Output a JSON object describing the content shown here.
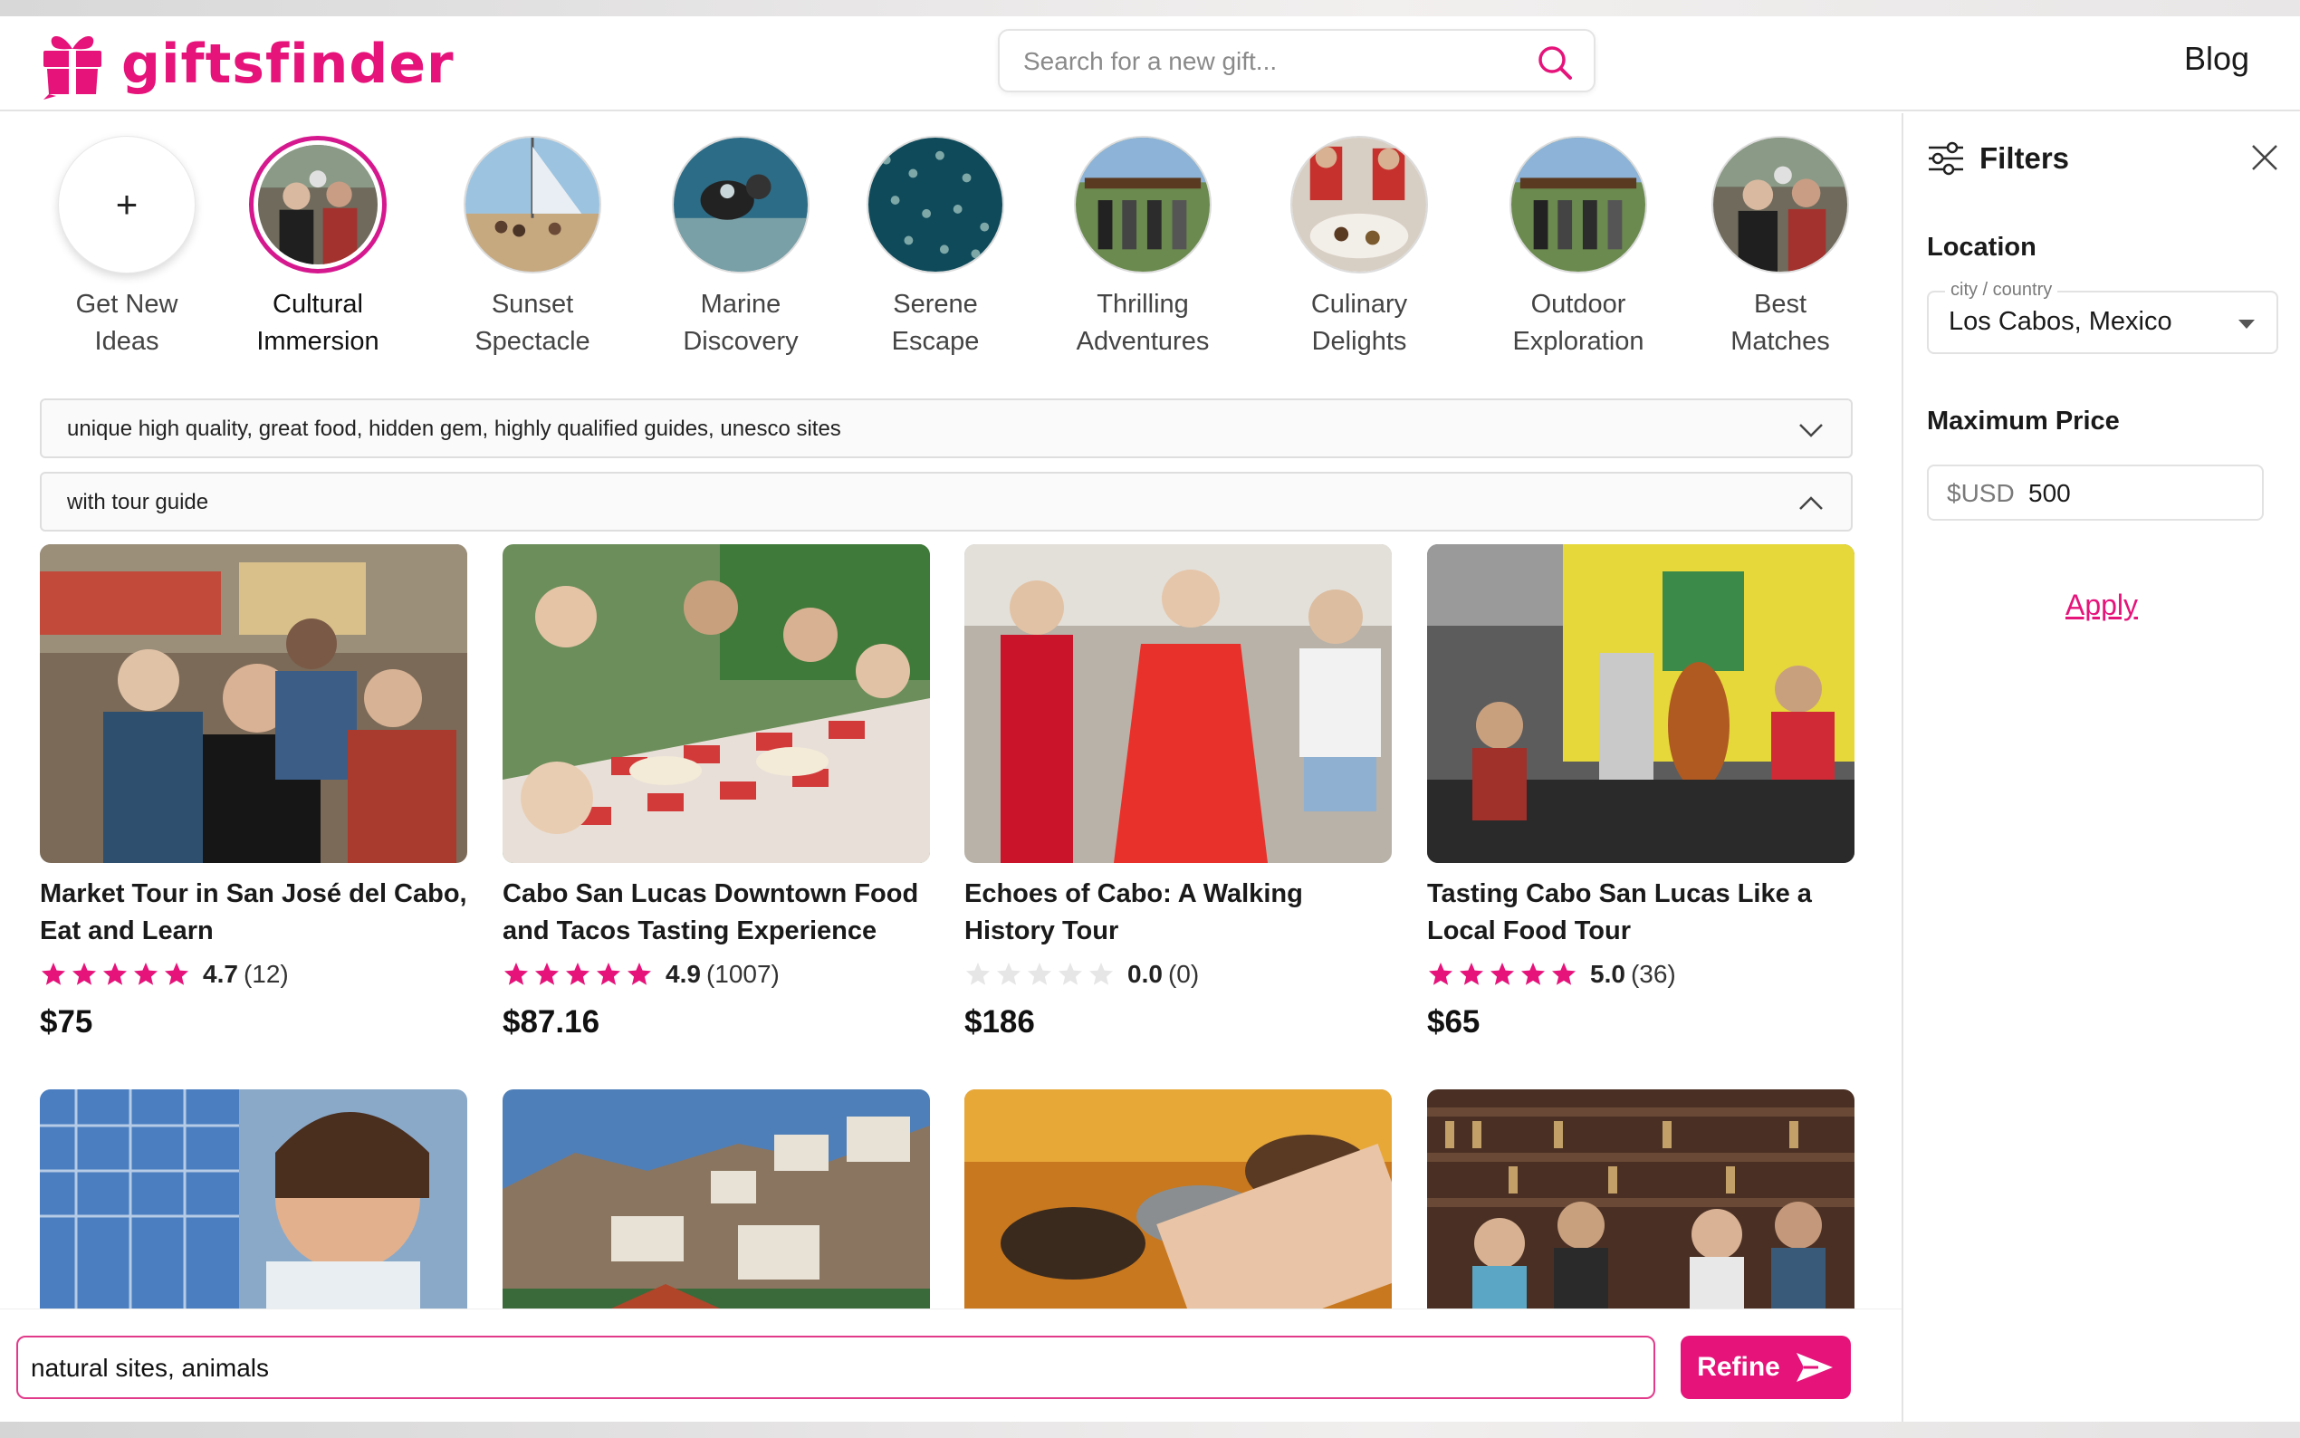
{
  "header": {
    "logo_text": "giftsfinder",
    "search_placeholder": "Search for a new gift...",
    "blog_label": "Blog"
  },
  "categories": [
    {
      "label": "Get New\nIdeas"
    },
    {
      "label": "Cultural\nImmersion"
    },
    {
      "label": "Sunset\nSpectacle"
    },
    {
      "label": "Marine\nDiscovery"
    },
    {
      "label": "Serene\nEscape"
    },
    {
      "label": "Thrilling\nAdventures"
    },
    {
      "label": "Culinary\nDelights"
    },
    {
      "label": "Outdoor\nExploration"
    },
    {
      "label": "Best\nMatches"
    }
  ],
  "refinements": [
    {
      "text": "unique high quality, great food, hidden gem, highly qualified guides, unesco sites",
      "state": "collapsed"
    },
    {
      "text": "with tour guide",
      "state": "expanded"
    }
  ],
  "products": [
    {
      "title": "Market Tour in San José del Cabo, Eat and Learn",
      "rating": 4.7,
      "rating_label": "4.7",
      "reviews": "(12)",
      "price": "$75"
    },
    {
      "title": "Cabo San Lucas Downtown Food and Tacos Tasting Experience",
      "rating": 4.9,
      "rating_label": "4.9",
      "reviews": "(1007)",
      "price": "$87.16"
    },
    {
      "title": "Echoes of Cabo: A Walking History Tour",
      "rating": 0,
      "rating_label": "0.0",
      "reviews": "(0)",
      "price": "$186"
    },
    {
      "title": "Tasting Cabo San Lucas Like a Local Food Tour",
      "rating": 5.0,
      "rating_label": "5.0",
      "reviews": "(36)",
      "price": "$65"
    }
  ],
  "refine": {
    "input_value": "natural sites, animals",
    "button_label": "Refine"
  },
  "filters": {
    "title": "Filters",
    "location_label": "Location",
    "location_legend": "city / country",
    "location_value": "Los Cabos, Mexico",
    "max_price_label": "Maximum Price",
    "currency": "$USD",
    "max_price_value": "500",
    "apply_label": "Apply"
  },
  "colors": {
    "brand": "#e5137a",
    "star_filled": "#e5137a",
    "star_empty": "#e6e6e6"
  }
}
